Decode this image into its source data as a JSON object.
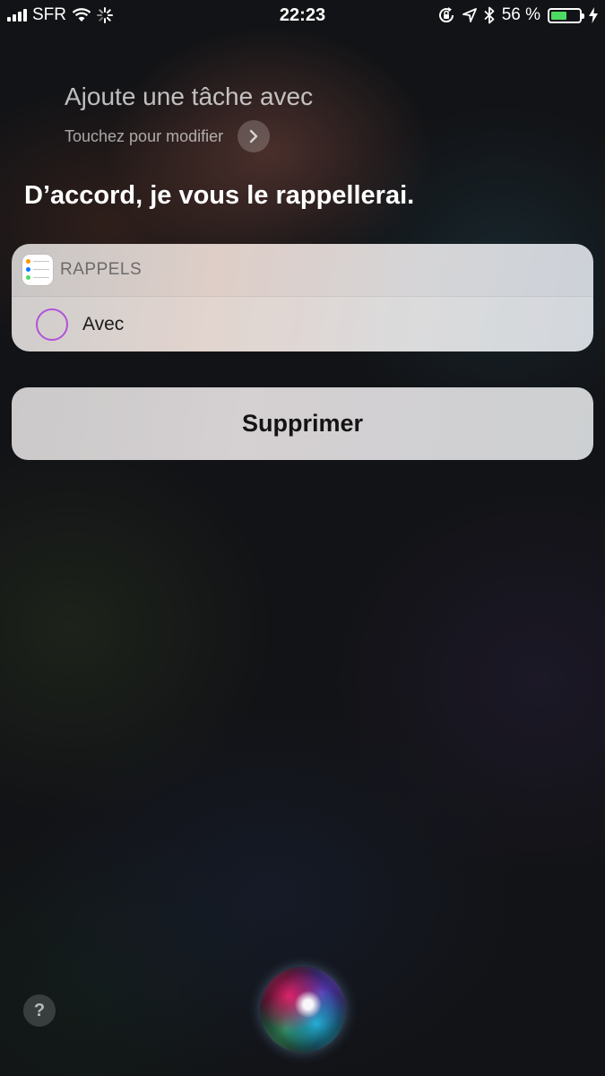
{
  "status_bar": {
    "carrier": "SFR",
    "time": "22:23",
    "battery_percent": "56 %",
    "battery_level": 0.56,
    "icons": [
      "signal-icon",
      "wifi-icon",
      "activity-spinner-icon",
      "orientation-lock-icon",
      "location-icon",
      "bluetooth-icon",
      "battery-icon",
      "charging-icon"
    ]
  },
  "siri": {
    "query": "Ajoute une tâche avec",
    "edit_hint": "Touchez pour modifier",
    "response": "D’accord, je vous le rappellerai."
  },
  "reminder_card": {
    "app_name": "RAPPELS",
    "item_label": "Avec",
    "checkbox_color": "#b053d9"
  },
  "actions": {
    "delete_label": "Supprimer"
  },
  "bottom": {
    "help_label": "?"
  }
}
